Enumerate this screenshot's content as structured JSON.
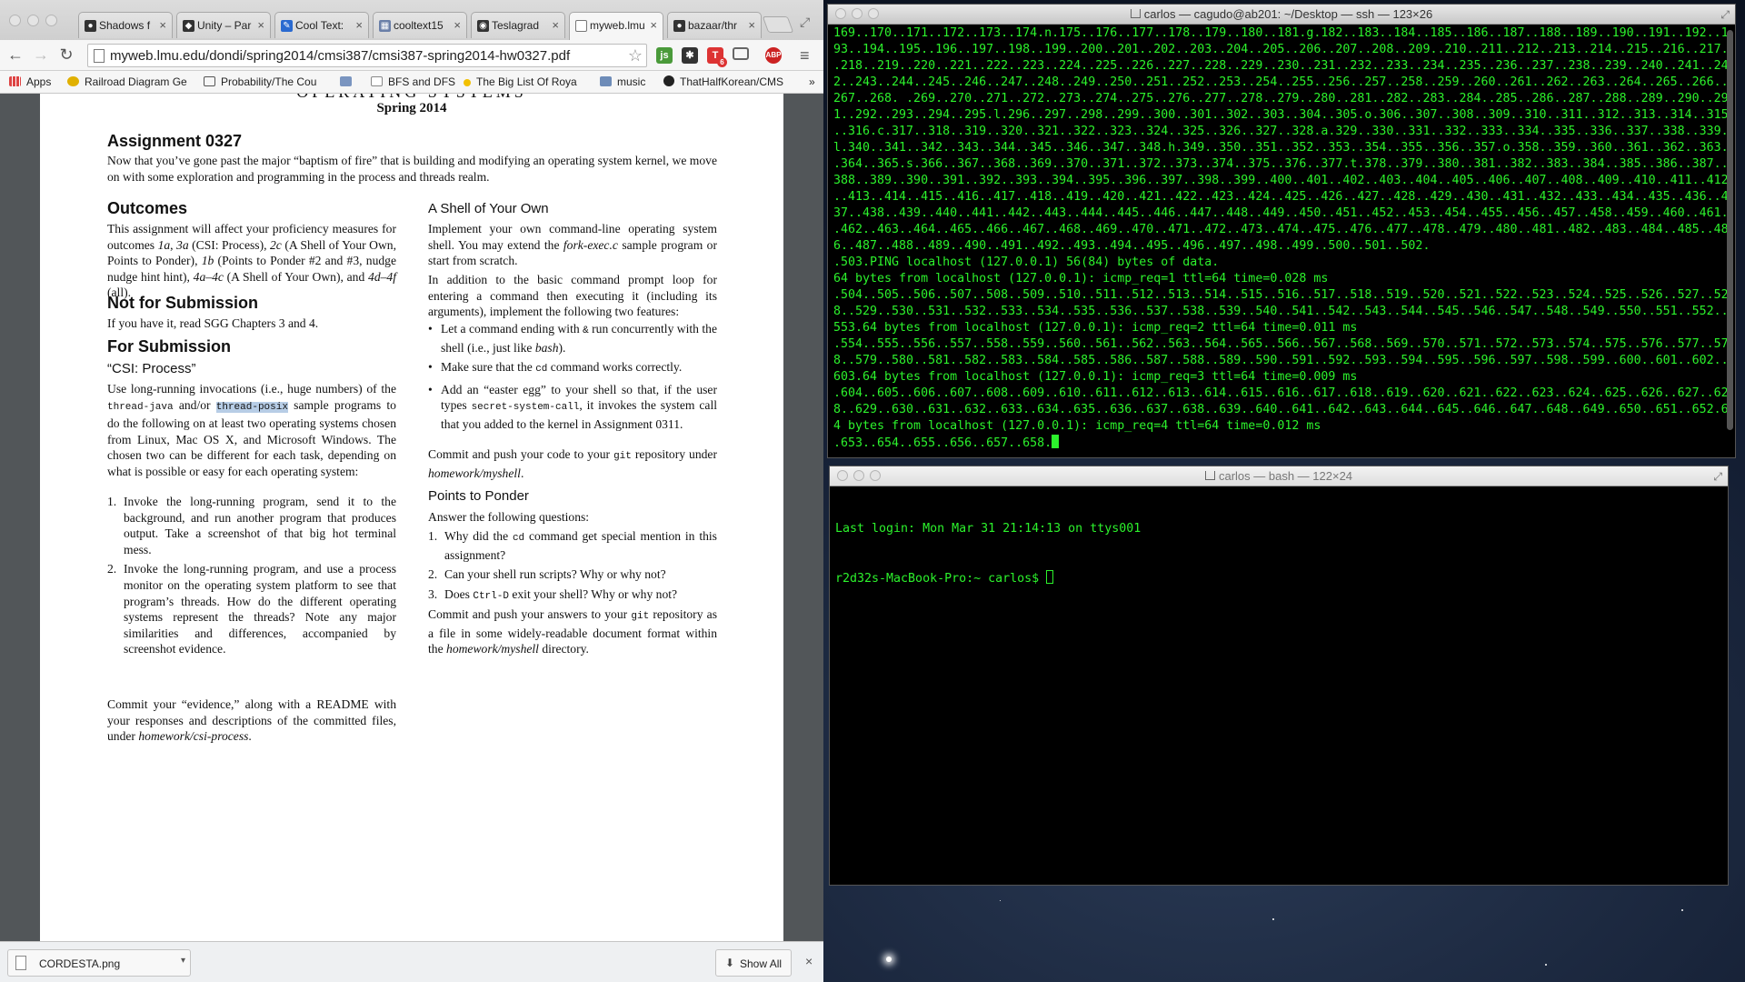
{
  "browser": {
    "tabs": [
      {
        "label": "Shadows f",
        "favicon": "github-icon"
      },
      {
        "label": "Unity – Par",
        "favicon": "unity-icon"
      },
      {
        "label": "Cool Text:",
        "favicon": "cooltext-icon"
      },
      {
        "label": "cooltext15",
        "favicon": "image-icon"
      },
      {
        "label": "Teslagrad",
        "favicon": "steam-icon"
      },
      {
        "label": "myweb.lmu",
        "favicon": "page-icon",
        "active": true
      },
      {
        "label": "bazaar/thr",
        "favicon": "github-icon"
      }
    ],
    "url": "myweb.lmu.edu/dondi/spring2014/cmsi387/cmsi387-spring2014-hw0327.pdf",
    "ext_badge": "6",
    "ext_abp": "ABP",
    "bookmarks": [
      {
        "label": "Apps",
        "icon": "apps-icon"
      },
      {
        "label": "Railroad Diagram Ge",
        "icon": "railroad-icon"
      },
      {
        "label": "Probability/The Cou",
        "icon": "wiki-icon"
      },
      {
        "label": "",
        "icon": "folder-image-icon"
      },
      {
        "label": "BFS and DFS",
        "icon": "page-icon"
      },
      {
        "label": "The Big List Of Roya",
        "icon": "star-icon"
      },
      {
        "label": "music",
        "icon": "folder-icon"
      },
      {
        "label": "ThatHalfKorean/CMS",
        "icon": "github-icon"
      },
      {
        "label": "»",
        "icon": "more-icon"
      }
    ],
    "downloads": {
      "file": "CORDESTA.png",
      "show_all": "Show All"
    }
  },
  "pdf": {
    "course": "OPERATING SYSTEMS",
    "semester": "Spring 2014",
    "assignment_title": "Assignment 0327",
    "intro": "Now that you’ve gone past the major “baptism of fire” that is building and modifying an operating system kernel, we move on with some exploration and programming in the process and threads realm.",
    "outcomes_heading": "Outcomes",
    "outcomes_p1": "This assignment will affect your proficiency measures for outcomes ",
    "outcomes_1a": "1a",
    "outcomes_sep1": ", ",
    "outcomes_3a": "3a",
    "outcomes_p2": " (CSI: Process), ",
    "outcomes_2c": "2c",
    "outcomes_p3": " (A Shell of Your Own, Points to Ponder), ",
    "outcomes_1b": "1b",
    "outcomes_p4": " (Points to Ponder #2 and #3, nudge nudge hint hint), ",
    "outcomes_4a4c": "4a–4c",
    "outcomes_p5": " (A Shell of Your Own), and ",
    "outcomes_4d4f": "4d–4f",
    "outcomes_p6": " (all).",
    "notfor_heading": "Not for Submission",
    "notfor_text": "If you have it, read SGG Chapters 3 and 4.",
    "forsub_heading": "For Submission",
    "csi_heading": "“CSI: Process”",
    "csi_p1": "Use long-running invocations (i.e., huge numbers) of the ",
    "csi_java": "thread-java",
    "csi_and": " and/or ",
    "csi_posix": "thread-posix",
    "csi_p2": " sample programs to do the following on at least two operating systems chosen from Linux, Mac OS X, and Microsoft Windows. The chosen two can be different for each task, depending on what is possible or easy for each operating system:",
    "csi_items": [
      {
        "num": "1.",
        "text": "Invoke the long-running program, send it to the background, and run another program that produces output. Take a screenshot of that big hot terminal mess."
      },
      {
        "num": "2.",
        "text": "Invoke the long-running program, and use a process monitor on the operating system platform to see that program’s threads. How do the different operating systems represent the threads? Note any major similarities and differences, accompanied by screenshot evidence."
      }
    ],
    "csi_commit": "Commit your “evidence,” along with a README with your responses and descriptions of the committed files, under ",
    "csi_commit_path": "homework/csi-process",
    "csi_commit_end": ".",
    "shell_heading": "A Shell of Your Own",
    "shell_p1": "Implement your own command-line operating system shell. You may extend the ",
    "shell_forkexec": "fork-exec.c",
    "shell_p1b": " sample program or start from scratch.",
    "shell_p2": "In addition to the basic command prompt loop for entering a command then executing it (including its arguments), implement the following two features:",
    "shell_b1a": "Let a command ending with ",
    "shell_b1code": "&",
    "shell_b1b": " run concurrently with the shell (i.e., just like ",
    "shell_b1bash": "bash",
    "shell_b1c": ").",
    "shell_b2a": "Make sure that the ",
    "shell_b2code": "cd",
    "shell_b2b": " command works correctly.",
    "shell_b3a": "Add an “easter egg” to your shell so that, if the user types ",
    "shell_b3code": "secret-system-call",
    "shell_b3b": ", it invokes the system call that you added to the kernel in Assignment 0311.",
    "shell_commit_a": "Commit and push your code to your ",
    "shell_commit_git": "git",
    "shell_commit_b": " repository under ",
    "shell_commit_path": "homework/myshell",
    "shell_commit_c": ".",
    "ponder_heading": "Points to Ponder",
    "ponder_intro": "Answer the following questions:",
    "ponder_q1a": "Why did the ",
    "ponder_q1code": "cd",
    "ponder_q1b": " command get special mention in this assignment?",
    "ponder_q2": "Can your shell run scripts? Why or why not?",
    "ponder_q3a": "Does ",
    "ponder_q3code": "Ctrl-D",
    "ponder_q3b": " exit your shell? Why or why not?",
    "ponder_nums": [
      "1.",
      "2.",
      "3."
    ],
    "ponder_commit_a": "Commit and push your answers to your ",
    "ponder_commit_git": "git",
    "ponder_commit_b": " repository as a file in some widely-readable document format within the ",
    "ponder_commit_path": "homework/myshell",
    "ponder_commit_c": " directory."
  },
  "terminal_ssh": {
    "title": "carlos — cagudo@ab201: ~/Desktop — ssh — 123×26",
    "lines": [
      "169..170..171..172..173..174.n.175..176..177..178..179..180..181.g.182..183..184..185..186..187..188..189..190..191..192..1",
      "93..194..195..196..197..198..199..200..201..202..203..204..205..206..207..208..209..210..211..212..213..214..215..216..217.",
      ".218..219..220..221..222..223..224..225..226..227..228..229..230..231..232..233..234..235..236..237..238..239..240..241..24",
      "2..243..244..245..246..247..248..249..250..251..252..253..254..255..256..257..258..259..260..261..262..263..264..265..266..",
      "267..268. .269..270..271..272..273..274..275..276..277..278..279..280..281..282..283..284..285..286..287..288..289..290..29",
      "1..292..293..294..295.l.296..297..298..299..300..301..302..303..304..305.o.306..307..308..309..310..311..312..313..314..315",
      "..316.c.317..318..319..320..321..322..323..324..325..326..327..328.a.329..330..331..332..333..334..335..336..337..338..339.",
      "l.340..341..342..343..344..345..346..347..348.h.349..350..351..352..353..354..355..356..357.o.358..359..360..361..362..363.",
      ".364..365.s.366..367..368..369..370..371..372..373..374..375..376..377.t.378..379..380..381..382..383..384..385..386..387..",
      "388..389..390..391..392..393..394..395..396..397..398..399..400..401..402..403..404..405..406..407..408..409..410..411..412",
      "..413..414..415..416..417..418..419..420..421..422..423..424..425..426..427..428..429..430..431..432..433..434..435..436..4",
      "37..438..439..440..441..442..443..444..445..446..447..448..449..450..451..452..453..454..455..456..457..458..459..460..461.",
      ".462..463..464..465..466..467..468..469..470..471..472..473..474..475..476..477..478..479..480..481..482..483..484..485..48",
      "6..487..488..489..490..491..492..493..494..495..496..497..498..499..500..501..502.",
      ".503.PING localhost (127.0.0.1) 56(84) bytes of data.",
      "64 bytes from localhost (127.0.0.1): icmp_req=1 ttl=64 time=0.028 ms",
      ".504..505..506..507..508..509..510..511..512..513..514..515..516..517..518..519..520..521..522..523..524..525..526..527..52",
      "8..529..530..531..532..533..534..535..536..537..538..539..540..541..542..543..544..545..546..547..548..549..550..551..552..",
      "553.64 bytes from localhost (127.0.0.1): icmp_req=2 ttl=64 time=0.011 ms",
      ".554..555..556..557..558..559..560..561..562..563..564..565..566..567..568..569..570..571..572..573..574..575..576..577..57",
      "8..579..580..581..582..583..584..585..586..587..588..589..590..591..592..593..594..595..596..597..598..599..600..601..602..",
      "603.64 bytes from localhost (127.0.0.1): icmp_req=3 ttl=64 time=0.009 ms",
      ".604..605..606..607..608..609..610..611..612..613..614..615..616..617..618..619..620..621..622..623..624..625..626..627..62",
      "8..629..630..631..632..633..634..635..636..637..638..639..640..641..642..643..644..645..646..647..648..649..650..651..652.6",
      "4 bytes from localhost (127.0.0.1): icmp_req=4 ttl=64 time=0.012 ms",
      ".653..654..655..656..657..658."
    ]
  },
  "terminal_bash": {
    "title": "carlos — bash — 122×24",
    "line1": "Last login: Mon Mar 31 21:14:13 on ttys001",
    "prompt": "r2d32s-MacBook-Pro:~ carlos$ "
  },
  "colors": {
    "terminal_text": "#2cf22c",
    "terminal_bg": "#000000",
    "selection": "#b7cde6"
  }
}
